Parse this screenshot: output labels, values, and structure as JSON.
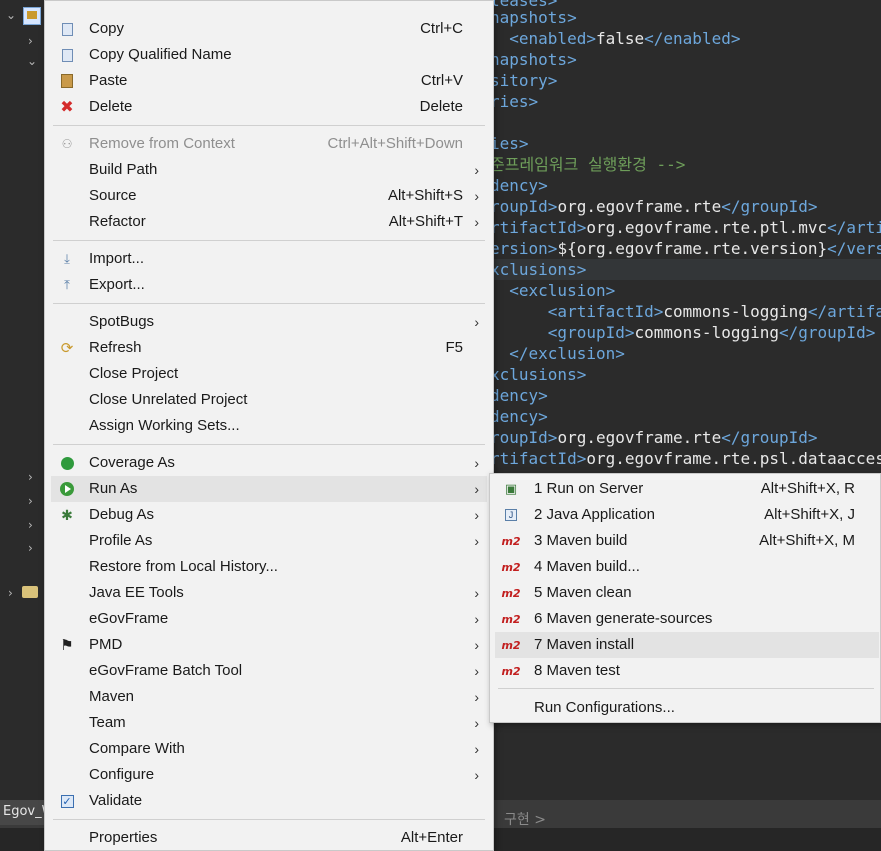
{
  "editor": {
    "lines": [
      {
        "parts": [
          {
            "t": "leases>",
            "c": "t-tag"
          }
        ]
      },
      {
        "parts": [
          {
            "t": "napshots>",
            "c": "t-tag"
          }
        ]
      },
      {
        "parts": [
          {
            "t": "  <enabled>",
            "c": "t-tag"
          },
          {
            "t": "false",
            "c": "t-txt"
          },
          {
            "t": "</enabled>",
            "c": "t-tag"
          }
        ]
      },
      {
        "parts": [
          {
            "t": "napshots>",
            "c": "t-tag"
          }
        ]
      },
      {
        "parts": [
          {
            "t": "sitory>",
            "c": "t-tag"
          }
        ]
      },
      {
        "parts": [
          {
            "t": "ries>",
            "c": "t-tag"
          }
        ]
      },
      {
        "parts": [
          {
            "t": "",
            "c": "t-tag"
          }
        ]
      },
      {
        "parts": [
          {
            "t": "ies>",
            "c": "t-tag"
          }
        ]
      },
      {
        "parts": [
          {
            "t": "준프레임워크 실행환경 -->",
            "c": "t-cmt"
          }
        ]
      },
      {
        "parts": [
          {
            "t": "dency>",
            "c": "t-tag"
          }
        ]
      },
      {
        "parts": [
          {
            "t": "roupId>",
            "c": "t-tag"
          },
          {
            "t": "org.egovframe.rte",
            "c": "t-txt"
          },
          {
            "t": "</groupId>",
            "c": "t-tag"
          }
        ]
      },
      {
        "parts": [
          {
            "t": "rtifactId>",
            "c": "t-tag"
          },
          {
            "t": "org.egovframe.rte.ptl.mvc",
            "c": "t-txt"
          },
          {
            "t": "</artifac",
            "c": "t-tag"
          }
        ]
      },
      {
        "parts": [
          {
            "t": "ersion>",
            "c": "t-tag"
          },
          {
            "t": "${org.egovframe.rte.version}",
            "c": "t-txt"
          },
          {
            "t": "</version",
            "c": "t-tag"
          }
        ]
      },
      {
        "parts": [
          {
            "t": "xclusions>",
            "c": "t-tag"
          }
        ]
      },
      {
        "parts": [
          {
            "t": "  <exclusion>",
            "c": "t-tag"
          }
        ]
      },
      {
        "parts": [
          {
            "t": "      <artifactId>",
            "c": "t-tag"
          },
          {
            "t": "commons-logging",
            "c": "t-txt"
          },
          {
            "t": "</artifactI",
            "c": "t-tag"
          }
        ]
      },
      {
        "parts": [
          {
            "t": "      <groupId>",
            "c": "t-tag"
          },
          {
            "t": "commons-logging",
            "c": "t-txt"
          },
          {
            "t": "</groupId>",
            "c": "t-tag"
          }
        ]
      },
      {
        "parts": [
          {
            "t": "  </exclusion>",
            "c": "t-tag"
          }
        ]
      },
      {
        "parts": [
          {
            "t": "xclusions>",
            "c": "t-tag"
          }
        ]
      },
      {
        "parts": [
          {
            "t": "dency>",
            "c": "t-tag"
          }
        ]
      },
      {
        "parts": [
          {
            "t": "dency>",
            "c": "t-tag"
          }
        ]
      },
      {
        "parts": [
          {
            "t": "roupId>",
            "c": "t-tag"
          },
          {
            "t": "org.egovframe.rte",
            "c": "t-txt"
          },
          {
            "t": "</groupId>",
            "c": "t-tag"
          }
        ]
      },
      {
        "parts": [
          {
            "t": "rtifactId>",
            "c": "t-tag"
          },
          {
            "t": "org.egovframe.rte.psl.dataaccess",
            "c": "t-txt"
          },
          {
            "t": "</",
            "c": "t-tag"
          }
        ]
      }
    ]
  },
  "status": {
    "tab_label": "Egov_W",
    "right_text": "구현 >"
  },
  "context_menu": {
    "groups": [
      [
        {
          "label": "Copy",
          "shortcut": "Ctrl+C",
          "icon": "copy-icon"
        },
        {
          "label": "Copy Qualified Name",
          "shortcut": "",
          "icon": "copy-icon"
        },
        {
          "label": "Paste",
          "shortcut": "Ctrl+V",
          "icon": "paste-icon"
        },
        {
          "label": "Delete",
          "shortcut": "Delete",
          "icon": "delete-icon"
        }
      ],
      [
        {
          "label": "Remove from Context",
          "shortcut": "Ctrl+Alt+Shift+Down",
          "icon": "remove-context-icon",
          "disabled": true
        },
        {
          "label": "Build Path",
          "submenu": true
        },
        {
          "label": "Source",
          "shortcut": "Alt+Shift+S",
          "submenu": true
        },
        {
          "label": "Refactor",
          "shortcut": "Alt+Shift+T",
          "submenu": true
        }
      ],
      [
        {
          "label": "Import...",
          "icon": "import-icon"
        },
        {
          "label": "Export...",
          "icon": "export-icon"
        }
      ],
      [
        {
          "label": "SpotBugs",
          "submenu": true
        },
        {
          "label": "Refresh",
          "shortcut": "F5",
          "icon": "refresh-icon"
        },
        {
          "label": "Close Project"
        },
        {
          "label": "Close Unrelated Project"
        },
        {
          "label": "Assign Working Sets..."
        }
      ],
      [
        {
          "label": "Coverage As",
          "submenu": true,
          "icon": "coverage-icon"
        },
        {
          "label": "Run As",
          "submenu": true,
          "icon": "run-icon",
          "hover": true
        },
        {
          "label": "Debug As",
          "submenu": true,
          "icon": "debug-icon"
        },
        {
          "label": "Profile As",
          "submenu": true
        },
        {
          "label": "Restore from Local History..."
        },
        {
          "label": "Java EE Tools",
          "submenu": true
        },
        {
          "label": "eGovFrame",
          "submenu": true
        },
        {
          "label": "PMD",
          "submenu": true,
          "icon": "pmd-icon"
        },
        {
          "label": "eGovFrame Batch Tool",
          "submenu": true
        },
        {
          "label": "Maven",
          "submenu": true
        },
        {
          "label": "Team",
          "submenu": true
        },
        {
          "label": "Compare With",
          "submenu": true
        },
        {
          "label": "Configure",
          "submenu": true
        },
        {
          "label": "Validate",
          "icon": "validate-checkbox-icon"
        }
      ],
      [
        {
          "label": "Properties",
          "shortcut": "Alt+Enter"
        }
      ]
    ]
  },
  "run_as_submenu": {
    "items": [
      {
        "label": "1 Run on Server",
        "shortcut": "Alt+Shift+X, R",
        "icon": "server-icon"
      },
      {
        "label": "2 Java Application",
        "shortcut": "Alt+Shift+X, J",
        "icon": "java-app-icon"
      },
      {
        "label": "3 Maven build",
        "shortcut": "Alt+Shift+X, M",
        "icon": "maven-icon"
      },
      {
        "label": "4 Maven build...",
        "shortcut": "",
        "icon": "maven-icon"
      },
      {
        "label": "5 Maven clean",
        "shortcut": "",
        "icon": "maven-icon"
      },
      {
        "label": "6 Maven generate-sources",
        "shortcut": "",
        "icon": "maven-icon"
      },
      {
        "label": "7 Maven install",
        "shortcut": "",
        "icon": "maven-icon",
        "hover": true
      },
      {
        "label": "8 Maven test",
        "shortcut": "",
        "icon": "maven-icon"
      }
    ],
    "footer": {
      "label": "Run Configurations..."
    },
    "maven_badge": "m2"
  }
}
